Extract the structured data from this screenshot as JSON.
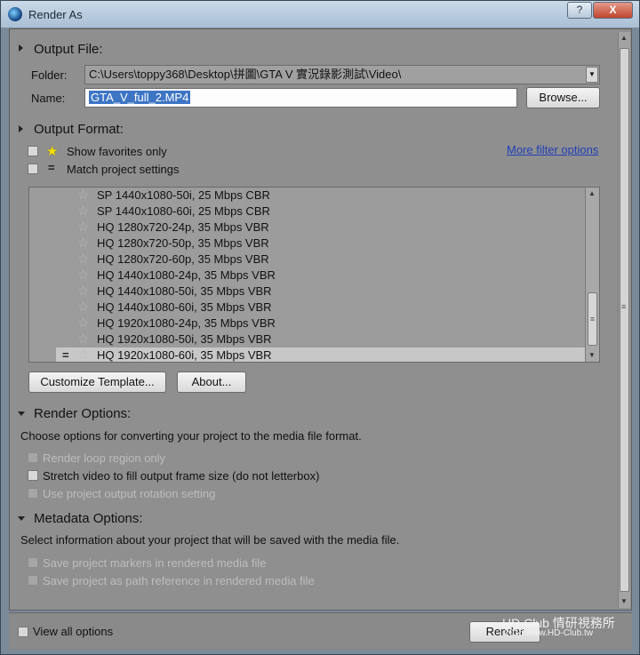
{
  "window": {
    "title": "Render As",
    "help_label": "?",
    "close_label": "X"
  },
  "output_file": {
    "header": "Output File:",
    "folder_label": "Folder:",
    "folder_value": "C:\\Users\\toppy368\\Desktop\\拼圖\\GTA V 實況錄影測試\\Video\\",
    "name_label": "Name:",
    "name_value": "GTA_V_full_2.MP4",
    "browse_label": "Browse..."
  },
  "output_format": {
    "header": "Output Format:",
    "favorites_label": "Show favorites only",
    "match_label": "Match project settings",
    "more_filter_label": "More filter options",
    "templates": [
      {
        "label": "SP 1440x1080-50i, 25 Mbps CBR",
        "selected": false
      },
      {
        "label": "SP 1440x1080-60i, 25 Mbps CBR",
        "selected": false
      },
      {
        "label": "HQ 1280x720-24p, 35 Mbps VBR",
        "selected": false
      },
      {
        "label": "HQ 1280x720-50p, 35 Mbps VBR",
        "selected": false
      },
      {
        "label": "HQ 1280x720-60p, 35 Mbps VBR",
        "selected": false
      },
      {
        "label": "HQ 1440x1080-24p, 35 Mbps VBR",
        "selected": false
      },
      {
        "label": "HQ 1440x1080-50i, 35 Mbps VBR",
        "selected": false
      },
      {
        "label": "HQ 1440x1080-60i, 35 Mbps VBR",
        "selected": false
      },
      {
        "label": "HQ 1920x1080-24p, 35 Mbps VBR",
        "selected": false
      },
      {
        "label": "HQ 1920x1080-50i, 35 Mbps VBR",
        "selected": false
      },
      {
        "label": "HQ 1920x1080-60i, 35 Mbps VBR",
        "selected": true
      }
    ],
    "customize_label": "Customize Template...",
    "about_label": "About..."
  },
  "render_options": {
    "header": "Render Options:",
    "description": "Choose options for converting your project to the media file format.",
    "loop_label": "Render loop region only",
    "stretch_label": "Stretch video to fill output frame size (do not letterbox)",
    "rotation_label": "Use project output rotation setting"
  },
  "metadata_options": {
    "header": "Metadata Options:",
    "description": "Select information about your project that will be saved with the media file.",
    "markers_label": "Save project markers in rendered media file",
    "path_label": "Save project as path reference in rendered media file"
  },
  "footer": {
    "view_all_label": "View all options",
    "render_label": "Render"
  },
  "watermark": {
    "line1": "HD.Club 情研視務所",
    "line2": "2015  www.HD-Club.tw"
  },
  "colors": {
    "selection": "#3d75c4",
    "link": "#1f3fb8",
    "panel": "#8f8f8f"
  }
}
